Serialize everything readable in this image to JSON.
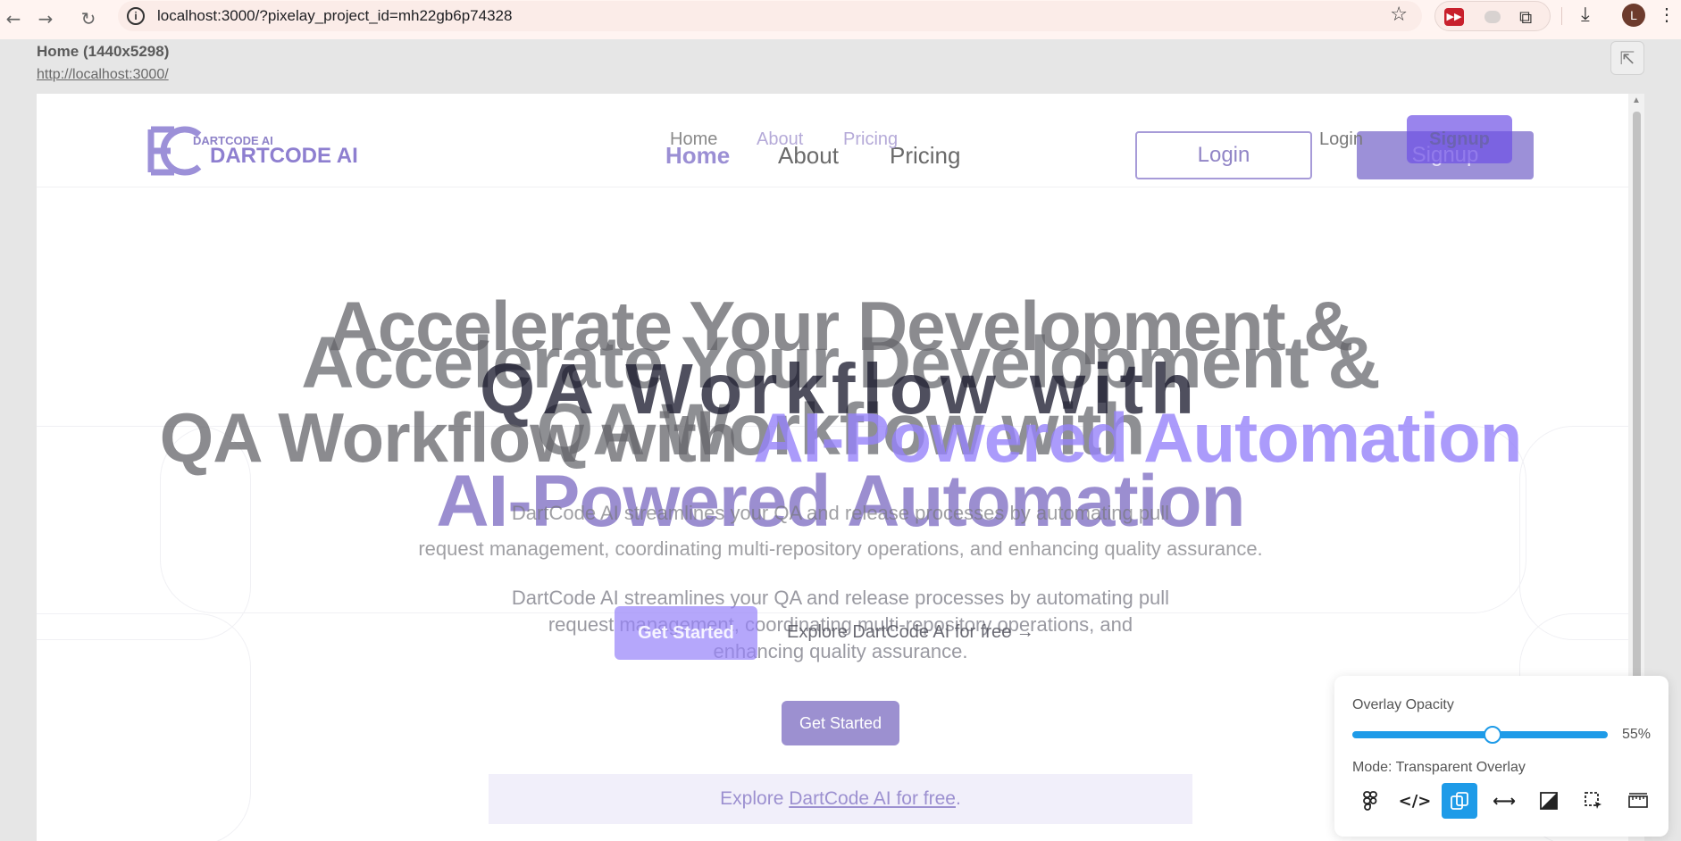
{
  "browser": {
    "url": "localhost:3000/?pixelay_project_id=mh22gb6p74328",
    "avatar_letter": "L"
  },
  "pixelay": {
    "page_label": "Home (1440x5298)",
    "page_link": "http://localhost:3000/"
  },
  "site": {
    "logo_text": "DARTCODE AI",
    "nav": [
      "Home",
      "About",
      "Pricing"
    ],
    "login": "Login",
    "signup": "Signup",
    "hero_line1": "Accelerate Your Development &",
    "hero_line2": "QA Workflow with",
    "hero_line3": "AI-Powered Automation",
    "subtitle_l1": "DartCode AI streamlines your QA and release processes by automating pull",
    "subtitle_l2": "request management, coordinating multi-repository operations, and",
    "subtitle_l3": "enhancing quality assurance.",
    "cta": "Get Started",
    "explore_prefix": "Explore ",
    "explore_link": "DartCode AI for free",
    "explore_suffix": "."
  },
  "overlay": {
    "logo_small": "DARTCODE AI",
    "nav": [
      "Home",
      "About",
      "Pricing"
    ],
    "login": "Login",
    "signup": "Signup",
    "hero_line1": "Accelerate Your Development &",
    "hero_line2_plain": "QA Workflow with ",
    "hero_line2_accent": "AI-Powered Automation",
    "subtitle_l1": "DartCode AI streamlines your QA and release processes by automating pull",
    "subtitle_l2": "request management, coordinating multi-repository operations, and enhancing quality assurance.",
    "cta": "Get Started",
    "explore": "Explore DartCode AI for free →"
  },
  "panel": {
    "opacity_label": "Overlay Opacity",
    "opacity_value": 55,
    "opacity_text": "55%",
    "mode_label": "Mode: Transparent Overlay",
    "tools": [
      "figma-icon",
      "code-icon",
      "overlay-icon",
      "split-icon",
      "difference-icon",
      "select-area-icon",
      "ruler-icon"
    ],
    "active_tool": "overlay-icon",
    "accent_color": "#1e9be8"
  },
  "colors": {
    "brand_purple": "#9c90d8"
  }
}
